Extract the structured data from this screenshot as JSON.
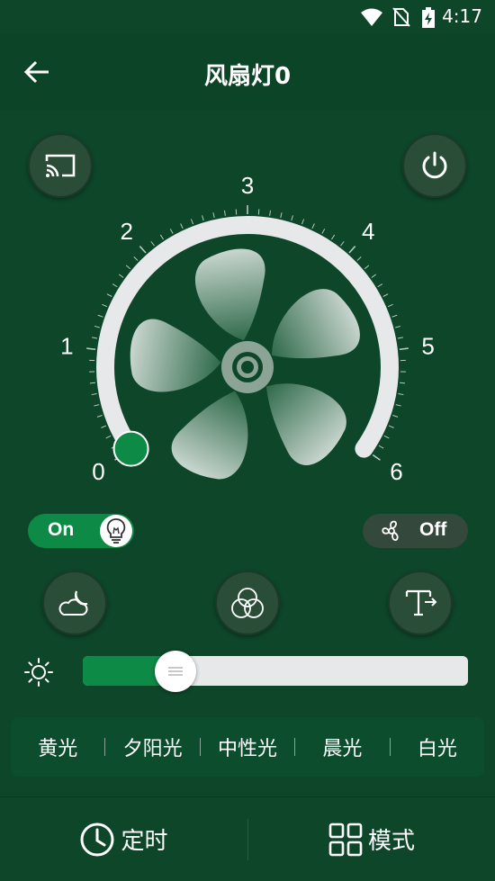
{
  "status_bar": {
    "time": "4:17",
    "icons": [
      "wifi-icon",
      "no-sim-icon",
      "battery-charging-icon"
    ]
  },
  "header": {
    "back_icon": "arrow-left-icon",
    "title": "风扇灯0"
  },
  "top_buttons": {
    "cast_icon": "cast-icon",
    "power_icon": "power-icon"
  },
  "dial": {
    "labels": [
      "0",
      "1",
      "2",
      "3",
      "4",
      "5",
      "6"
    ],
    "value": 0,
    "min": 0,
    "max": 6,
    "center_icon": "fan-blade-icon"
  },
  "light_toggle": {
    "label": "On",
    "state": true,
    "icon": "lightbulb-icon"
  },
  "fan_toggle": {
    "label": "Off",
    "state": false,
    "icon": "fan-icon"
  },
  "mode_buttons": [
    {
      "icon": "moon-cloud-icon"
    },
    {
      "icon": "color-circles-icon"
    },
    {
      "icon": "text-width-icon"
    }
  ],
  "brightness": {
    "icon": "sun-icon",
    "value": 0.13
  },
  "color_temps": [
    "黄光",
    "夕阳光",
    "中性光",
    "晨光",
    "白光"
  ],
  "bottom_nav": {
    "timer_label": "定时",
    "timer_icon": "clock-icon",
    "mode_label": "模式",
    "mode_icon": "grid-icon"
  },
  "colors": {
    "background": "#0d4629",
    "accent": "#0d8a45",
    "track": "#e6e8ea"
  }
}
